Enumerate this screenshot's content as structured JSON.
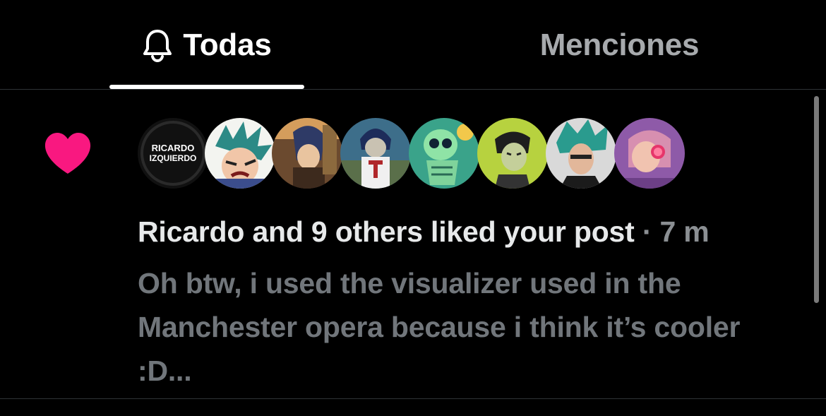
{
  "tabs": [
    {
      "label": "Todas",
      "icon": "bell-icon",
      "active": true
    },
    {
      "label": "Menciones",
      "active": false
    }
  ],
  "notification": {
    "icon": "heart-icon",
    "icon_color": "#f91880",
    "avatars": [
      {
        "name": "avatar-ricardo",
        "text_line1": "RICARDO",
        "text_line2": "IZQUIERDO"
      },
      {
        "name": "avatar-2"
      },
      {
        "name": "avatar-3"
      },
      {
        "name": "avatar-4"
      },
      {
        "name": "avatar-5"
      },
      {
        "name": "avatar-6"
      },
      {
        "name": "avatar-7"
      },
      {
        "name": "avatar-8"
      }
    ],
    "title": "Ricardo and 9 others liked your post",
    "separator": " · ",
    "time": "7 m",
    "body": "Oh btw, i used the visualizer used in the Manchester opera because i think it’s cooler :D..."
  },
  "colors": {
    "background": "#000000",
    "primary_text": "#e7e9ea",
    "secondary_text": "#71767b",
    "divider": "#2f3336",
    "like": "#f91880"
  }
}
